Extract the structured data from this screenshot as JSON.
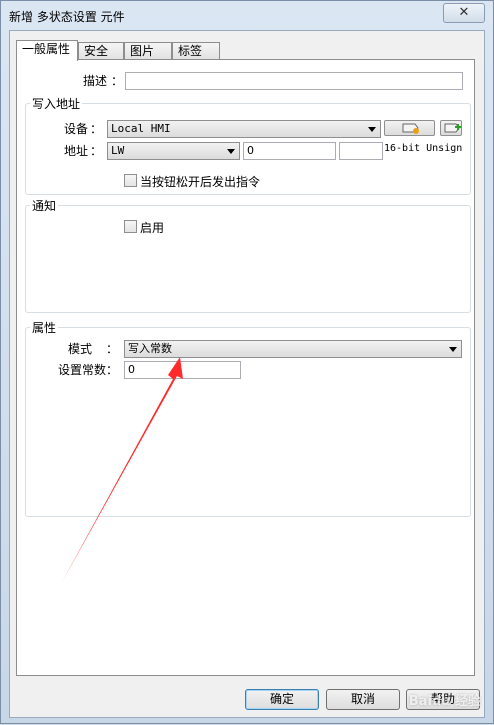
{
  "window": {
    "title": "新增 多状态设置 元件",
    "close_label": "✕"
  },
  "tabs": [
    {
      "label": "一般属性"
    },
    {
      "label": "安全"
    },
    {
      "label": "图片"
    },
    {
      "label": "标签"
    }
  ],
  "general": {
    "description_label": "描述",
    "description_value": "",
    "colon": "："
  },
  "write_address": {
    "group_title": "写入地址",
    "device_label": "设备",
    "device_value": "Local HMI",
    "address_label": "地址",
    "address_type": "LW",
    "address_value": "0",
    "data_format": "16-bit Unsign",
    "release_checkbox_label": "当按钮松开后发出指令",
    "release_checked": false
  },
  "notify": {
    "group_title": "通知",
    "enable_label": "启用",
    "enable_checked": false
  },
  "attributes": {
    "group_title": "属性",
    "mode_label": "模式",
    "mode_value": "写入常数",
    "constant_label": "设置常数",
    "constant_value": "0"
  },
  "footer": {
    "ok_label": "确定",
    "cancel_label": "取消",
    "help_label": "帮助"
  },
  "watermark": "Baidu 经验",
  "colors": {
    "annotation_arrow": "#ff2a2a"
  }
}
